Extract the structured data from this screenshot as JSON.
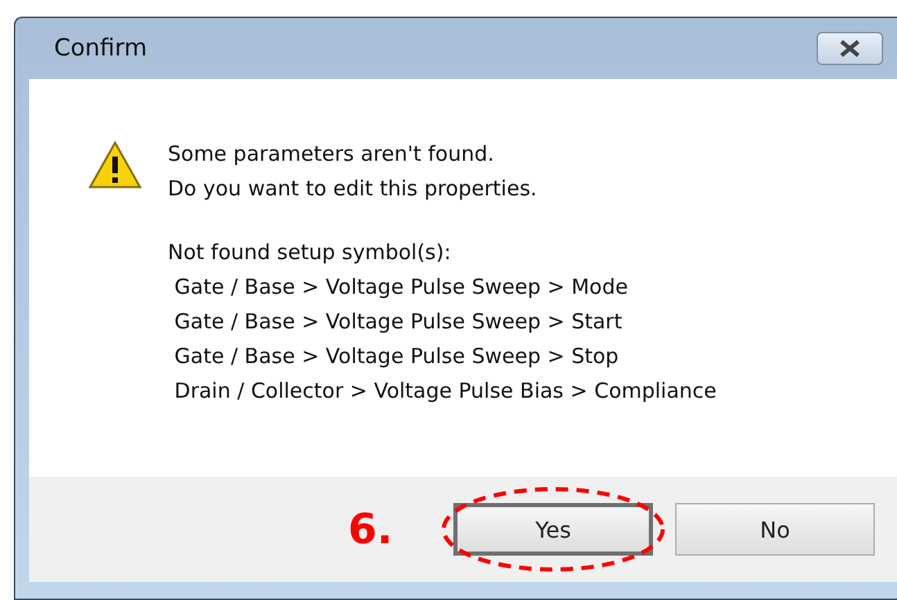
{
  "window": {
    "title": "Confirm"
  },
  "message": {
    "lines": [
      "Some parameters aren't found.",
      "Do you want to edit this properties."
    ]
  },
  "details": {
    "heading": "Not found setup symbol(s):",
    "items": [
      " Gate / Base > Voltage Pulse Sweep > Mode",
      " Gate / Base > Voltage Pulse Sweep > Start",
      " Gate / Base > Voltage Pulse Sweep > Stop",
      " Drain / Collector > Voltage Pulse Bias > Compliance"
    ]
  },
  "annotation": {
    "label": "6."
  },
  "buttons": [
    {
      "label": "Yes",
      "selected": true,
      "highlighted": true
    },
    {
      "label": "No",
      "selected": false,
      "highlighted": false
    }
  ]
}
